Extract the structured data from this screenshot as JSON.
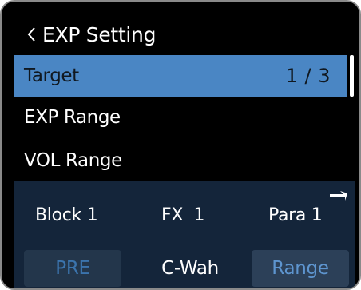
{
  "header": {
    "title": "EXP Setting",
    "back_icon": "chevron-left-icon"
  },
  "menu": {
    "items": [
      {
        "label": "Target",
        "value": "1 / 3",
        "selected": true
      },
      {
        "label": "EXP Range",
        "value": "",
        "selected": false
      },
      {
        "label": "VOL Range",
        "value": "",
        "selected": false
      }
    ]
  },
  "panel": {
    "block_label": "Block 1",
    "fx_label": "FX  1",
    "para_label": "Para 1",
    "corner_icon": "return-arrow-icon",
    "pre_button": "PRE",
    "fx_name": "C-Wah",
    "range_button": "Range"
  },
  "colors": {
    "background": "#000000",
    "selected_row": "#4a86c4",
    "panel": "#14253a",
    "button": "#23364b",
    "button_text_dim": "#3b74ad",
    "button_text_active": "#5e95cf"
  }
}
